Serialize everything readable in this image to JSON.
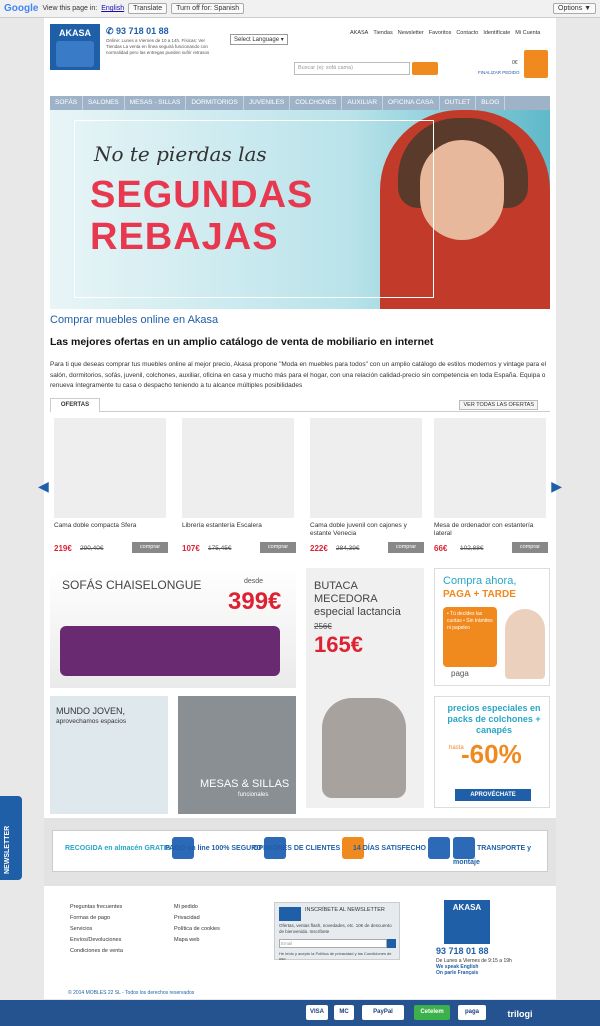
{
  "translate_bar": {
    "google": "Google",
    "view_text": "View this page in:",
    "language": "English",
    "translate_btn": "Translate",
    "turn_off_btn": "Turn off for: Spanish",
    "options_btn": "Options ▼"
  },
  "header": {
    "logo": "AKASA",
    "phone": "93 718 01 88",
    "hours": "Online: Lunes a Viernes de 10 a 14h. Físicas: Ver Tiendas La venta en línea seguirá funcionando con normalidad pero las entregas pueden sufrir retrasos",
    "language_select": "Select Language",
    "top_links": [
      "AKASA",
      "Tiendas",
      "Newsletter",
      "Favoritos",
      "Contacto",
      "Identifícate",
      "Mi Cuenta"
    ],
    "search_placeholder": "Buscar (ej: sofá cama)",
    "cart_price": "0€",
    "cart_label": "FINALIZAR PEDIDO"
  },
  "nav": [
    "SOFÁS",
    "SALONES",
    "MESAS - SILLAS",
    "DORMITORIOS",
    "JUVENILES",
    "COLCHONES",
    "AUXILIAR",
    "OFICINA CASA",
    "OUTLET",
    "BLOG"
  ],
  "banner": {
    "line1": "No te pierdas las",
    "line2": "SEGUNDAS",
    "line3": "REBAJAS"
  },
  "intro": {
    "title": "Comprar muebles online en Akasa",
    "heading": "Las mejores ofertas en un amplio catálogo de venta de mobiliario en internet",
    "paragraph": "Para ti que deseas comprar tus muebles online al mejor precio, Akasa propone \"Moda en muebles para todos\" con un amplio catálogo de estilos modernos y vintage para el salón, dormitorios, sofás, juvenil, colchones, auxiliar, oficina en casa y mucho más para el hogar, con una relación calidad-precio sin competencia en toda España. Equipa o renueva íntegramente tu casa o despacho teniendo a tu alcance múltiples posibilidades"
  },
  "offers": {
    "tab": "OFERTAS",
    "view_all": "VER TODAS LAS OFERTAS",
    "products": [
      {
        "name": "Cama doble compacta Sfera",
        "price": "219€",
        "old": "290,40€",
        "buy": "comprar"
      },
      {
        "name": "Librería estantería Escalera",
        "price": "107€",
        "old": "175,45€",
        "buy": "comprar"
      },
      {
        "name": "Cama doble juvenil con cajones y estante Venecia",
        "price": "222€",
        "old": "284,39€",
        "buy": "comprar"
      },
      {
        "name": "Mesa de ordenador con estantería lateral",
        "price": "66€",
        "old": "102,88€",
        "buy": "comprar"
      }
    ]
  },
  "promos": {
    "sofa": {
      "title": "SOFÁS CHAISELONGUE",
      "desde": "desde",
      "price": "399€"
    },
    "butaca": {
      "title": "BUTACA MECEDORA especial lactancia",
      "old": "256€",
      "price": "165€"
    },
    "paga": {
      "t1": "Compra ahora,",
      "t2": "PAGA + TARDE",
      "bubble": "• Tú decides las cuotas • Sin trámites ni papeleo",
      "logo": "paga"
    },
    "joven": {
      "title": "MUNDO JOVEN,",
      "sub": "aprovechamos espacios"
    },
    "mesas": {
      "title": "MESAS & SILLAS",
      "sub": "funcionales"
    },
    "colchones": {
      "title": "precios especiales en packs de colchones + canapés",
      "hasta": "hasta",
      "pct": "-60%",
      "btn": "APROVÉCHATE"
    }
  },
  "features": [
    {
      "label": "RECOGIDA en almacén GRATIS"
    },
    {
      "label": "PAGO on line 100% SEGURO"
    },
    {
      "label": "OPINIONES DE CLIENTES"
    },
    {
      "label": "14 DÍAS SATISFECHO"
    },
    {
      "label": "TRANSPORTE y montaje"
    }
  ],
  "footer": {
    "col1": [
      "Preguntas frecuentes",
      "Formas de pago",
      "Servicios",
      "Envíos/Devoluciones",
      "Condiciones de venta"
    ],
    "col2": [
      "Mi pedido",
      "Privacidad",
      "Política de cookies",
      "Mapa web"
    ],
    "newsletter_title": "INSCRÍBETE AL NEWSLETTER",
    "newsletter_desc": "Ofertas, ventas flash, novedades, etc. 10€ de descuento de bienvenida. Inscríbete",
    "newsletter_placeholder": "Email",
    "newsletter_check": "He leído y acepto la Política de privacidad y las Condiciones de uso",
    "logo": "AKASA",
    "phone": "93 718 01 88",
    "hours": "De Lunes a Viernes de 9:15 a 19h",
    "english": "We speak English",
    "french": "On parle Français",
    "copyright": "© 2014 MOBLES 22 SL - Todos los derechos reservados"
  },
  "side_tab": "NEWSLETTER",
  "payments": [
    "VISA",
    "MC",
    "PayPal",
    "Cetelem",
    "paga",
    "trilogi"
  ]
}
